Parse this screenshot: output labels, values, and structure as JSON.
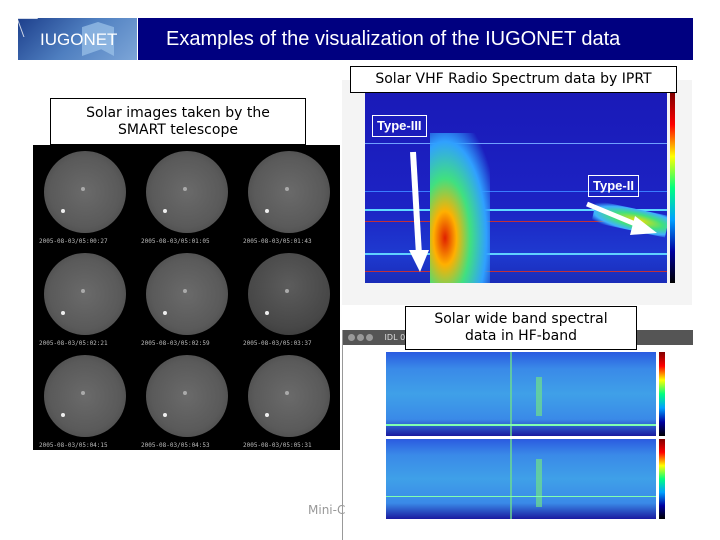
{
  "header": {
    "logo_text": "IUGONET",
    "title": "Examples of the visualization of the IUGONET data"
  },
  "solar_images": {
    "label": "Solar images taken by the SMART telescope",
    "label_line1": "Solar images taken by the",
    "label_line2": "SMART telescope",
    "timestamps": [
      "2005-08-03/05:00:27",
      "2005-08-03/05:01:05",
      "2005-08-03/05:01:43",
      "2005-08-03/05:02:21",
      "2005-08-03/05:02:59",
      "2005-08-03/05:03:37",
      "2005-08-03/05:04:15",
      "2005-08-03/05:04:53",
      "2005-08-03/05:05:31"
    ]
  },
  "vhf": {
    "label": "Solar VHF Radio Spectrum data by IPRT",
    "type3_label": "Type-III",
    "type2_label": "Type-II"
  },
  "hf": {
    "label_line1": "Solar wide band spectral",
    "label_line2": "data in HF-band",
    "window_title": "IDL 0"
  },
  "footer": {
    "text": "Mini-C"
  },
  "colors": {
    "title_band": "#000080",
    "spectrum_background": "#1a1ab8"
  }
}
